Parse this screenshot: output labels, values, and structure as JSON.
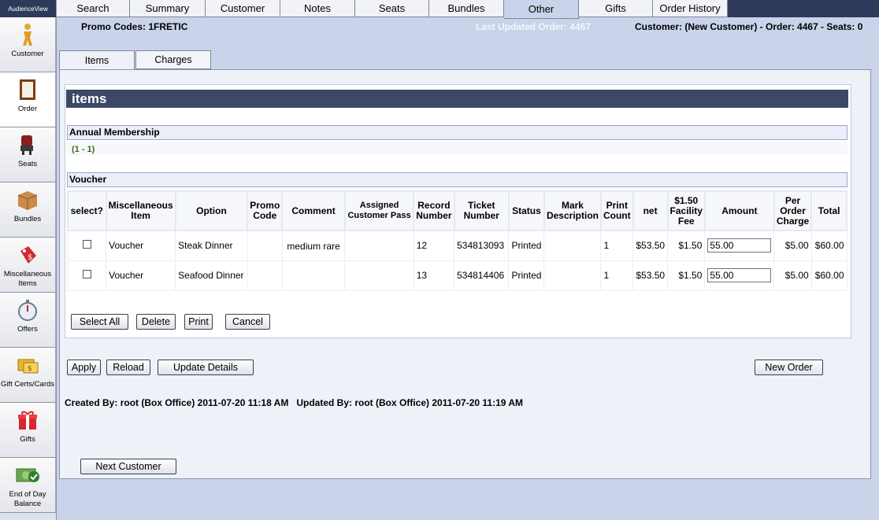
{
  "brand": "AudienceView",
  "sidebar": {
    "items": [
      {
        "label": "Customer",
        "icon": "person-icon"
      },
      {
        "label": "Order",
        "icon": "order-icon"
      },
      {
        "label": "Seats",
        "icon": "seats-icon"
      },
      {
        "label": "Bundles",
        "icon": "bundles-icon"
      },
      {
        "label": "Miscellaneous Items",
        "icon": "price-tag-icon"
      },
      {
        "label": "Offers",
        "icon": "stopwatch-icon"
      },
      {
        "label": "Gift Certs/Cards",
        "icon": "gift-card-icon"
      },
      {
        "label": "Gifts",
        "icon": "gift-icon"
      },
      {
        "label": "End of Day Balance",
        "icon": "money-check-icon"
      }
    ]
  },
  "top_tabs": [
    "Search",
    "Summary",
    "Customer",
    "Notes",
    "Seats",
    "Bundles",
    "Other",
    "Gifts",
    "Order History"
  ],
  "active_top_tab": "Other",
  "header": {
    "promo_label": "Promo Codes:",
    "promo_value": "1FRETIC",
    "last_updated": "Last Updated Order: 4467",
    "summary": "Customer: (New Customer) - Order: 4467 - Seats: 0"
  },
  "sub_tabs": [
    "Items",
    "Charges"
  ],
  "items_title": "items",
  "annual_membership": {
    "label": "Annual Membership",
    "range": "(1 - 1)"
  },
  "voucher": {
    "label": "Voucher",
    "columns": [
      "select?",
      "Miscellaneous Item",
      "Option",
      "Promo Code",
      "Comment",
      "Assigned Customer Pass",
      "Record Number",
      "Ticket Number",
      "Status",
      "Mark Description",
      "Print Count",
      "net",
      "$1.50 Facility Fee",
      "Amount",
      "Per Order Charge",
      "Total"
    ],
    "rows": [
      {
        "item": "Voucher",
        "option": "Steak Dinner",
        "promo": "",
        "comment": "medium rare",
        "pass": "",
        "record": "12",
        "ticket": "534813093",
        "status": "Printed",
        "mark": "",
        "print_count": "1",
        "net": "$53.50",
        "fee": "$1.50",
        "amount": "55.00",
        "per_order": "$5.00",
        "total": "$60.00"
      },
      {
        "item": "Voucher",
        "option": "Seafood Dinner",
        "promo": "",
        "comment": "",
        "pass": "",
        "record": "13",
        "ticket": "534814406",
        "status": "Printed",
        "mark": "",
        "print_count": "1",
        "net": "$53.50",
        "fee": "$1.50",
        "amount": "55.00",
        "per_order": "$5.00",
        "total": "$60.00"
      }
    ]
  },
  "buttons": {
    "select_all": "Select All",
    "delete": "Delete",
    "print": "Print",
    "cancel": "Cancel",
    "apply": "Apply",
    "reload": "Reload",
    "update_details": "Update Details",
    "new_order": "New Order",
    "next_customer": "Next Customer"
  },
  "footer": {
    "created": "Created By: root (Box Office) 2011-07-20 11:18 AM",
    "updated": "Updated By: root (Box Office) 2011-07-20 11:19 AM"
  }
}
